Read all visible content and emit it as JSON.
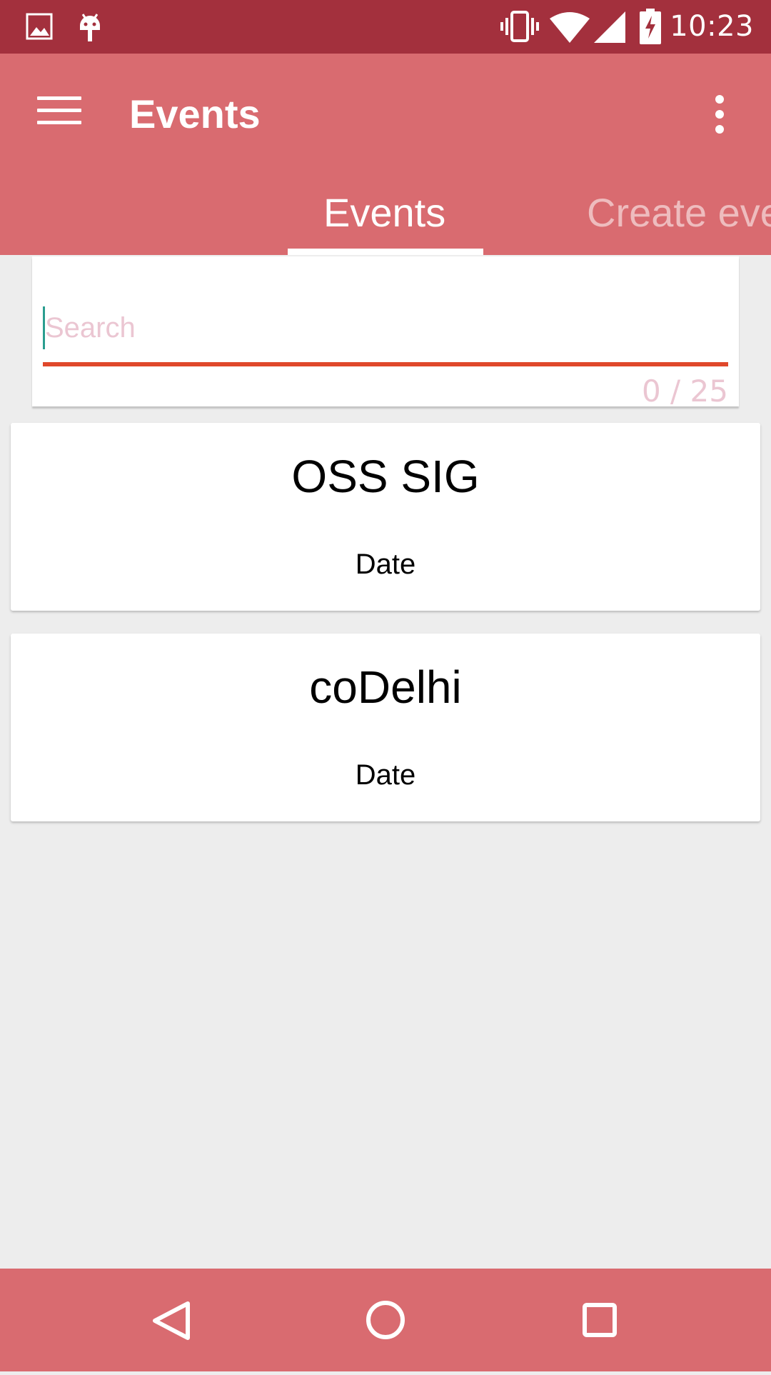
{
  "status_bar": {
    "time": "10:23",
    "left_icons": [
      "image-icon",
      "android-icon"
    ],
    "right_icons": [
      "vibrate-icon",
      "wifi-icon",
      "signal-icon",
      "battery-charging-icon"
    ]
  },
  "app_bar": {
    "title": "Events",
    "menu_icon": "menu-icon",
    "overflow_icon": "more-vert-icon",
    "color": "#D96B70"
  },
  "tabs": [
    {
      "label": "Events",
      "selected": true
    },
    {
      "label": "Create eve",
      "selected": false
    }
  ],
  "search": {
    "placeholder": "Search",
    "value": "",
    "counter": "0 / 25",
    "underline_color": "#E0482B"
  },
  "events": [
    {
      "name": "OSS SIG",
      "date": "Date"
    },
    {
      "name": "coDelhi",
      "date": "Date"
    }
  ],
  "nav_bar": {
    "buttons": [
      "back-icon",
      "home-icon",
      "recents-icon"
    ]
  },
  "colors": {
    "status_bar": "#A3303D",
    "primary": "#D96B70",
    "background": "#EDEDED"
  }
}
